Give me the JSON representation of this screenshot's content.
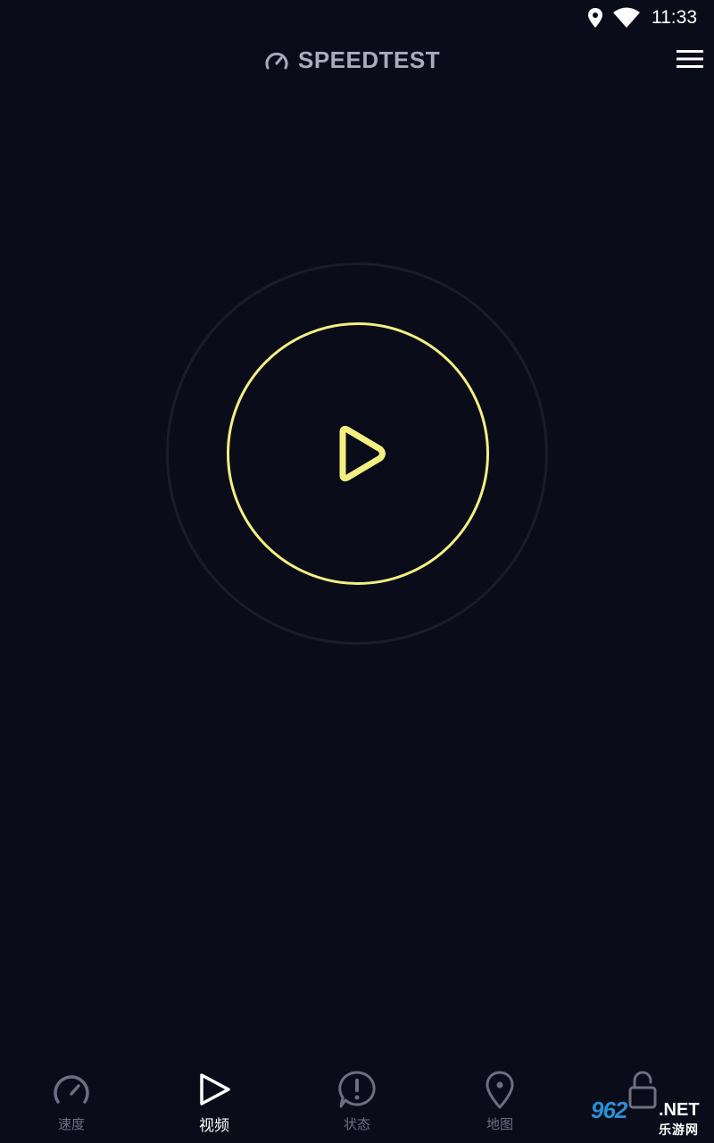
{
  "status_bar": {
    "time": "11:33",
    "icons": [
      "location-icon",
      "wifi-icon"
    ]
  },
  "header": {
    "brand": "SPEEDTEST",
    "icons": [
      "speedometer-icon",
      "hamburger-menu-icon"
    ]
  },
  "main": {
    "start_button_icon": "play-icon",
    "colors": {
      "accent": "#f3f081",
      "background": "#0a0c1a",
      "ring": "#1a1c28"
    }
  },
  "bottom_nav": {
    "items": [
      {
        "label": "速度",
        "icon": "speedometer-icon",
        "active": false
      },
      {
        "label": "视频",
        "icon": "play-icon",
        "active": true
      },
      {
        "label": "状态",
        "icon": "alert-icon",
        "active": false
      },
      {
        "label": "地图",
        "icon": "map-pin-icon",
        "active": false
      },
      {
        "label": "",
        "icon": "lock-icon",
        "active": false
      }
    ]
  },
  "watermark": {
    "brand": "962",
    "suffix": ".NET",
    "sub": "乐游网"
  }
}
